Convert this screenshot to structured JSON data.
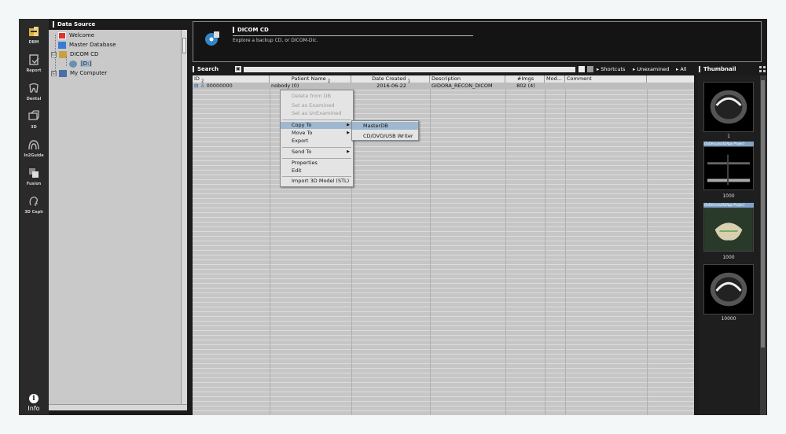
{
  "toolbar": {
    "items": [
      {
        "label": "DBM",
        "icon": "database-icon"
      },
      {
        "label": "Report",
        "icon": "report-icon"
      },
      {
        "label": "Dental",
        "icon": "tooth-icon"
      },
      {
        "label": "3D",
        "icon": "3d-cube-icon"
      },
      {
        "label": "In2Guide",
        "icon": "guide-icon"
      },
      {
        "label": "Fusion",
        "icon": "fusion-icon"
      },
      {
        "label": "3D Ceph",
        "icon": "ceph-head-icon"
      }
    ],
    "info_label": "Info",
    "info_glyph": "i"
  },
  "data_source": {
    "title": "Data Source",
    "tree": [
      {
        "label": "Welcome",
        "icon": "welcome-icon"
      },
      {
        "label": "Master Database",
        "icon": "database-icon"
      },
      {
        "label": "DICOM CD",
        "icon": "cd-icon",
        "expander": "⊟"
      },
      {
        "label": "[D:]",
        "icon": "drive-icon"
      },
      {
        "label": "My Computer",
        "icon": "computer-icon",
        "expander": "⊞"
      }
    ]
  },
  "banner": {
    "title": "DICOM CD",
    "subtitle": "Explore a backup CD, or DICOM-Dic."
  },
  "search": {
    "label": "Search",
    "button_glyph": "▣",
    "filters": [
      "Shortcuts",
      "Unexamined",
      "All"
    ]
  },
  "thumbnail": {
    "title": "Thumbnail",
    "items": [
      {
        "caption": "1",
        "banner": ""
      },
      {
        "caption": "1000",
        "banner": "OnDemand3DApp Project"
      },
      {
        "caption": "1000",
        "banner": "OnDemand3DApp Project"
      },
      {
        "caption": "10000",
        "banner": ""
      }
    ]
  },
  "table": {
    "columns": [
      "ID",
      "Patient Name",
      "Date Created",
      "Description",
      "#Imgs",
      "Mod...",
      "Comment"
    ],
    "sort_markers": [
      "2",
      "2",
      "1",
      "",
      "",
      "",
      ""
    ],
    "rows": [
      {
        "id": "00000000",
        "patient_name": "nobody (0)",
        "date_created": "2016-06-22",
        "description": "GIDORA_RECON_DICOM",
        "imgs": "802 (4)",
        "mod": "",
        "comment": ""
      }
    ]
  },
  "context_menu": {
    "items": [
      {
        "label": "Delete from DB",
        "disabled": true
      },
      {
        "label": "Set as Examined",
        "disabled": true
      },
      {
        "label": "Set as UnExamined",
        "disabled": true
      },
      {
        "label": "Copy To",
        "submenu": true,
        "selected": true
      },
      {
        "label": "Move To",
        "submenu": true
      },
      {
        "label": "Export"
      },
      {
        "label": "Send To",
        "submenu": true
      },
      {
        "label": "Properties"
      },
      {
        "label": "Edit"
      },
      {
        "label": "Import 3D Model (STL)"
      }
    ],
    "submenu": [
      "MasterDB",
      "CD/DVD/USB Writer"
    ]
  },
  "colors": {
    "menu_highlight": "#9fb8cf",
    "panel_dark": "#1b1b1b",
    "thumb_banner": "#7fa3c7"
  }
}
